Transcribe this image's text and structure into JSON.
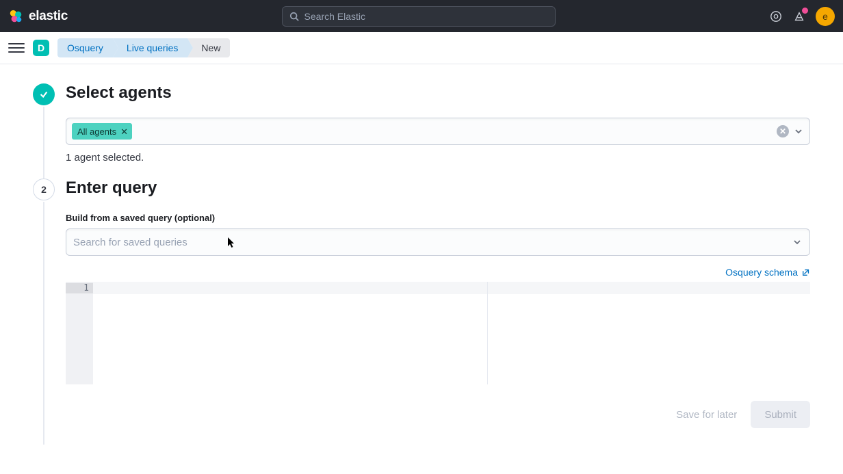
{
  "brand": {
    "name": "elastic"
  },
  "search": {
    "placeholder": "Search Elastic"
  },
  "avatar": {
    "initial": "e"
  },
  "space": {
    "initial": "D"
  },
  "breadcrumbs": [
    {
      "label": "Osquery",
      "active": false
    },
    {
      "label": "Live queries",
      "active": false
    },
    {
      "label": "New",
      "active": true
    }
  ],
  "step1": {
    "title": "Select agents",
    "chip": "All agents",
    "helper": "1 agent selected."
  },
  "step2": {
    "number": "2",
    "title": "Enter query",
    "saved_label": "Build from a saved query (optional)",
    "saved_placeholder": "Search for saved queries",
    "schema_link": "Osquery schema",
    "line_number": "1"
  },
  "actions": {
    "save": "Save for later",
    "submit": "Submit"
  }
}
